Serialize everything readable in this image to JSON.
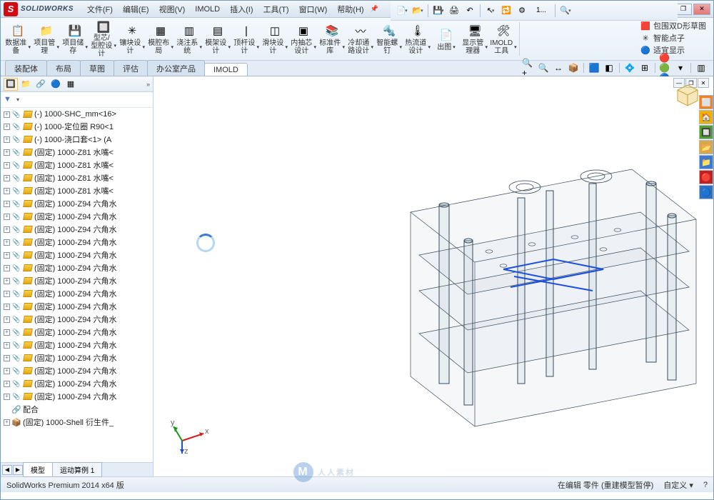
{
  "app": {
    "name": "SOLIDWORKS",
    "logo_letter": "S"
  },
  "menu": [
    {
      "label": "文件(F)"
    },
    {
      "label": "编辑(E)"
    },
    {
      "label": "视图(V)"
    },
    {
      "label": "IMOLD"
    },
    {
      "label": "插入(I)"
    },
    {
      "label": "工具(T)"
    },
    {
      "label": "窗口(W)"
    },
    {
      "label": "帮助(H)"
    }
  ],
  "quick": {
    "new_doc": "📄",
    "open": "📂",
    "save": "💾",
    "print": "🖨",
    "undo": "↶",
    "select": "↖",
    "rebuild": "🔁",
    "options": "⚙",
    "one": "1...",
    "search": "🔍"
  },
  "command_manager": [
    {
      "icon": "📋",
      "label": "数据准备"
    },
    {
      "icon": "📁",
      "label": "项目管理"
    },
    {
      "icon": "💾",
      "label": "项目储存"
    },
    {
      "icon": "🔲",
      "label": "型芯/型腔设计"
    },
    {
      "icon": "✳",
      "label": "镶块设计"
    },
    {
      "icon": "▦",
      "label": "模腔布局"
    },
    {
      "icon": "▥",
      "label": "浇注系统"
    },
    {
      "icon": "▤",
      "label": "模架设计"
    },
    {
      "icon": "|",
      "label": "顶杆设计"
    },
    {
      "icon": "◫",
      "label": "滑块设计"
    },
    {
      "icon": "▣",
      "label": "内抽芯设计"
    },
    {
      "icon": "📚",
      "label": "标准件库"
    },
    {
      "icon": "〰",
      "label": "冷却通路设计"
    },
    {
      "icon": "🔩",
      "label": "智能螺钉"
    },
    {
      "icon": "🌡",
      "label": "热流道设计"
    },
    {
      "icon": "📄",
      "label": "出图"
    },
    {
      "icon": "🖥",
      "label": "显示管理器"
    },
    {
      "icon": "🛠",
      "label": "IMOLD工具"
    }
  ],
  "cmd_right": [
    {
      "icon": "🟥",
      "label": "包围双D形草图"
    },
    {
      "icon": "✳",
      "label": "智能点子",
      "color": "#d08020"
    },
    {
      "icon": "🔵",
      "label": "适宜显示"
    }
  ],
  "tabs": [
    {
      "label": "装配体"
    },
    {
      "label": "布局"
    },
    {
      "label": "草图"
    },
    {
      "label": "评估"
    },
    {
      "label": "办公室产品"
    },
    {
      "label": "IMOLD",
      "active": true
    }
  ],
  "viewtools": [
    {
      "g": "🔍+"
    },
    {
      "g": "🔍"
    },
    {
      "g": "↔"
    },
    {
      "g": "📦"
    },
    {
      "sep": true
    },
    {
      "g": "🟦"
    },
    {
      "g": "◧"
    },
    {
      "sep": true
    },
    {
      "g": "💠"
    },
    {
      "g": "⊞"
    },
    {
      "sep": true
    },
    {
      "g": "🔴🟢🔵"
    },
    {
      "g": "▾"
    },
    {
      "sep": true
    },
    {
      "g": "▥"
    }
  ],
  "fp_tabs": [
    {
      "g": "🔲",
      "active": true
    },
    {
      "g": "📁"
    },
    {
      "g": "🔗"
    },
    {
      "g": "🔵"
    },
    {
      "g": "▦"
    }
  ],
  "tree": [
    {
      "label": "(-) 1000-SHC_mm<16>"
    },
    {
      "label": "(-) 1000-定位圈 R90<1"
    },
    {
      "label": "(-) 1000-浇口套<1> (A"
    },
    {
      "label": "(固定) 1000-Z81 水嘴<"
    },
    {
      "label": "(固定) 1000-Z81 水嘴<"
    },
    {
      "label": "(固定) 1000-Z81 水嘴<"
    },
    {
      "label": "(固定) 1000-Z81 水嘴<"
    },
    {
      "label": "(固定) 1000-Z94 六角水"
    },
    {
      "label": "(固定) 1000-Z94 六角水"
    },
    {
      "label": "(固定) 1000-Z94 六角水"
    },
    {
      "label": "(固定) 1000-Z94 六角水"
    },
    {
      "label": "(固定) 1000-Z94 六角水"
    },
    {
      "label": "(固定) 1000-Z94 六角水"
    },
    {
      "label": "(固定) 1000-Z94 六角水"
    },
    {
      "label": "(固定) 1000-Z94 六角水"
    },
    {
      "label": "(固定) 1000-Z94 六角水"
    },
    {
      "label": "(固定) 1000-Z94 六角水"
    },
    {
      "label": "(固定) 1000-Z94 六角水"
    },
    {
      "label": "(固定) 1000-Z94 六角水"
    },
    {
      "label": "(固定) 1000-Z94 六角水"
    },
    {
      "label": "(固定) 1000-Z94 六角水"
    },
    {
      "label": "(固定) 1000-Z94 六角水"
    },
    {
      "label": "(固定) 1000-Z94 六角水"
    },
    {
      "label": "配合",
      "mate": true
    },
    {
      "label": "(固定) 1000-Shell 衍生件_",
      "assy": true
    }
  ],
  "bottom_tabs": [
    {
      "label": "模型",
      "active": true
    },
    {
      "label": "运动算例 1"
    }
  ],
  "side_tabs": [
    {
      "g": "⬜",
      "c": "#f48020"
    },
    {
      "g": "🏠",
      "c": "#f4b000"
    },
    {
      "g": "🔲",
      "c": "#50a030"
    },
    {
      "g": "📂",
      "c": "#d6a848"
    },
    {
      "g": "📁",
      "c": "#3a7ad0"
    },
    {
      "g": "🔴",
      "c": "#c02020"
    },
    {
      "g": "🔵",
      "c": "#3070c0"
    }
  ],
  "doc_controls": [
    "—",
    "❐",
    "✕"
  ],
  "view_win": [
    "—",
    "❐",
    "✕"
  ],
  "status": {
    "left": "SolidWorks Premium 2014 x64 版",
    "mid": "在编辑 零件 (重建模型暂停)",
    "right": "自定义 ▾",
    "end": "?"
  },
  "triad": {
    "x": "x",
    "y": "y",
    "z": "z"
  },
  "watermark": "人人素材"
}
